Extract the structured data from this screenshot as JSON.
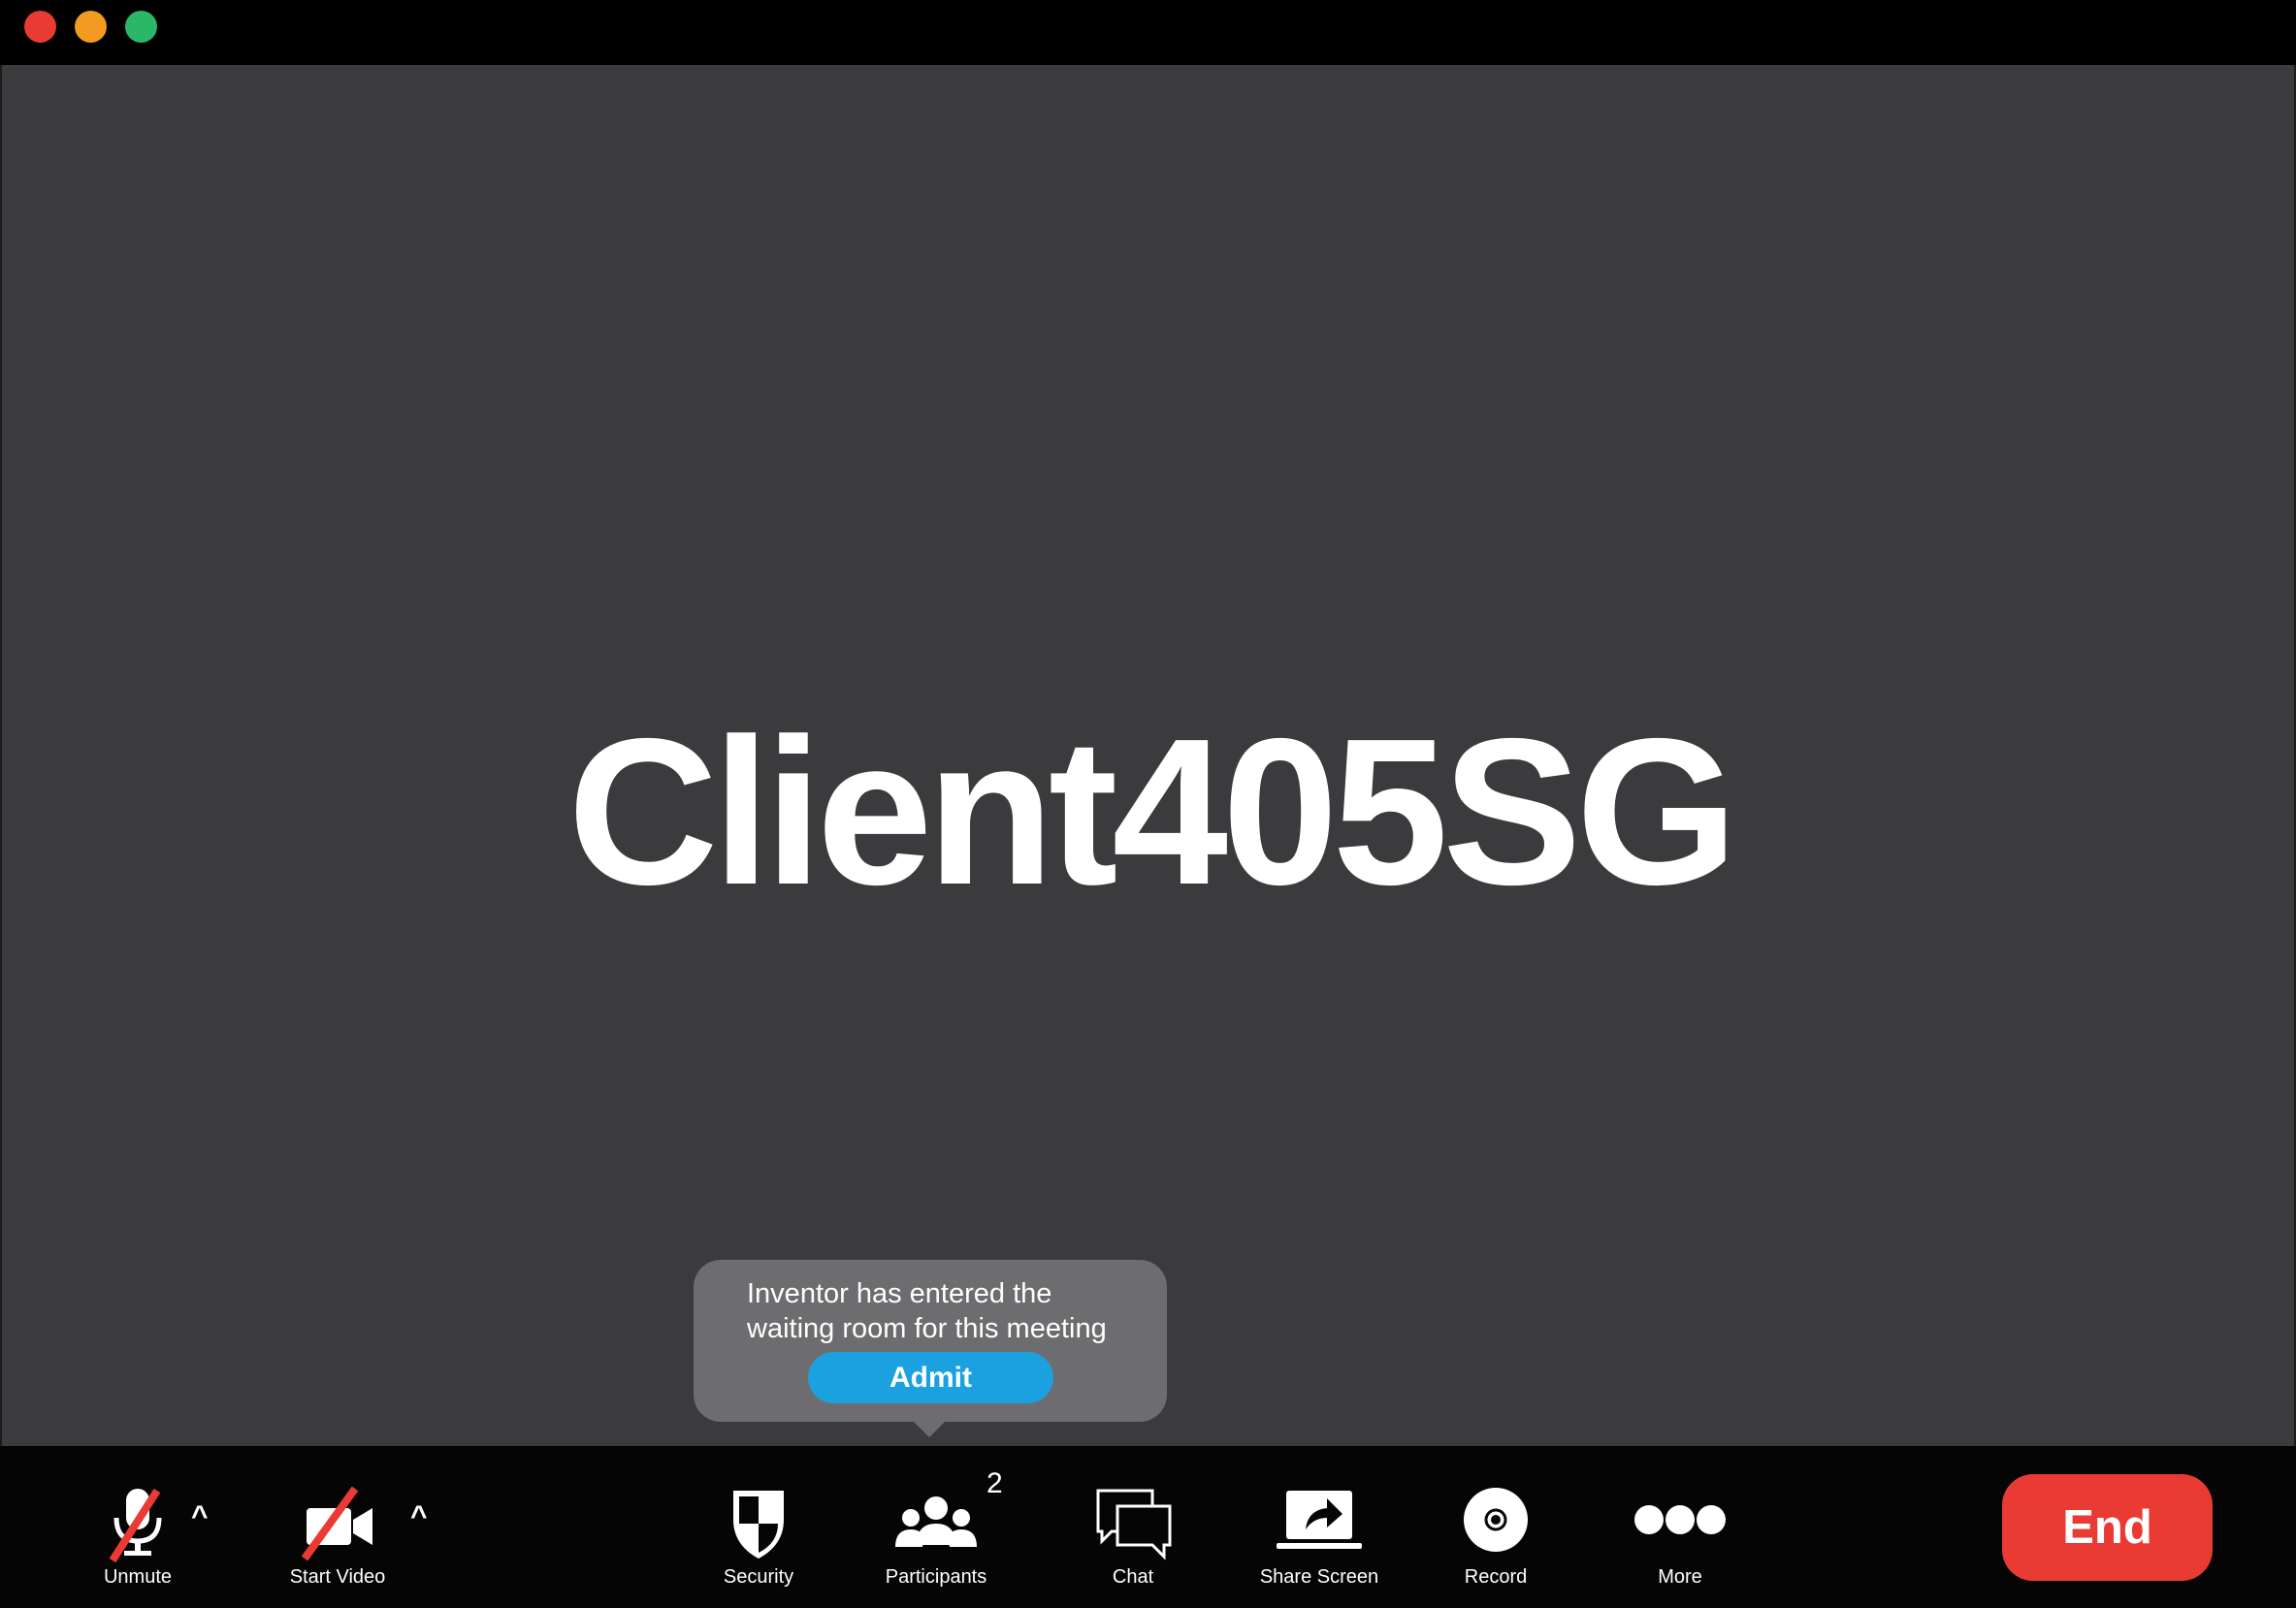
{
  "window": {
    "traffic_lights": {
      "close": "#e93a34",
      "minimize": "#f39a21",
      "zoom": "#2ab868"
    }
  },
  "stage": {
    "participant_name": "Client405SG"
  },
  "waiting_room_popup": {
    "message": "Inventor has entered the\nwaiting room for this meeting",
    "admit_label": "Admit"
  },
  "toolbar": {
    "unmute": {
      "label": "Unmute",
      "icon": "microphone-muted-icon",
      "caret": "^"
    },
    "start_video": {
      "label": "Start Video",
      "icon": "video-off-icon",
      "caret": "^"
    },
    "security": {
      "label": "Security",
      "icon": "shield-icon"
    },
    "participants": {
      "label": "Participants",
      "icon": "participants-icon",
      "count": "2"
    },
    "chat": {
      "label": "Chat",
      "icon": "chat-bubbles-icon"
    },
    "share_screen": {
      "label": "Share Screen",
      "icon": "share-screen-icon"
    },
    "record": {
      "label": "Record",
      "icon": "record-icon"
    },
    "more": {
      "label": "More",
      "icon": "more-dots-icon"
    },
    "end": {
      "label": "End",
      "color": "#e93a34"
    }
  }
}
